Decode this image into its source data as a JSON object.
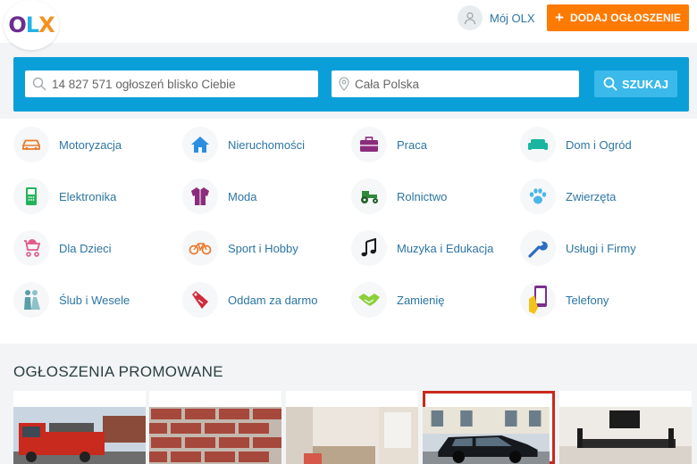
{
  "header": {
    "logo_letters": [
      "O",
      "L",
      "X"
    ],
    "my_olx_label": "Mój OLX",
    "add_listing_label": "DODAJ OGŁOSZENIE"
  },
  "search": {
    "query_placeholder": "14 827 571 ogłoszeń blisko Ciebie",
    "location_placeholder": "Cała Polska",
    "button_label": "SZUKAJ"
  },
  "categories": [
    {
      "label": "Motoryzacja",
      "icon": "car-icon",
      "color": "#e97a2c"
    },
    {
      "label": "Nieruchomości",
      "icon": "house-icon",
      "color": "#2b8fe1"
    },
    {
      "label": "Praca",
      "icon": "briefcase-icon",
      "color": "#8b2c7c"
    },
    {
      "label": "Dom i Ogród",
      "icon": "sofa-icon",
      "color": "#19b5a0"
    },
    {
      "label": "Elektronika",
      "icon": "phone-icon",
      "color": "#23b35a"
    },
    {
      "label": "Moda",
      "icon": "jacket-icon",
      "color": "#8b2c7c"
    },
    {
      "label": "Rolnictwo",
      "icon": "tractor-icon",
      "color": "#2f8a3a"
    },
    {
      "label": "Zwierzęta",
      "icon": "paw-icon",
      "color": "#4cb6e8"
    },
    {
      "label": "Dla Dzieci",
      "icon": "stroller-icon",
      "color": "#e05a8a"
    },
    {
      "label": "Sport i Hobby",
      "icon": "bicycle-icon",
      "color": "#e97a2c"
    },
    {
      "label": "Muzyka i Edukacja",
      "icon": "music-note-icon",
      "color": "#1a1a1a"
    },
    {
      "label": "Usługi i Firmy",
      "icon": "wrench-icon",
      "color": "#2b6cc4"
    },
    {
      "label": "Ślub i Wesele",
      "icon": "wedding-couple-icon",
      "color": "#5a9ea8"
    },
    {
      "label": "Oddam za darmo",
      "icon": "price-tag-icon",
      "color": "#d02c3b"
    },
    {
      "label": "Zamienię",
      "icon": "handshake-icon",
      "color": "#8ccf3b"
    },
    {
      "label": "Telefony",
      "icon": "smartphone-hand-icon",
      "color": "#f2c318"
    }
  ],
  "promoted": {
    "title": "OGŁOSZENIA PROMOWANE",
    "cards": [
      {
        "image": "tow-truck-photo"
      },
      {
        "image": "brick-wall-photo"
      },
      {
        "image": "room-interior-photo"
      },
      {
        "image": "black-car-photo",
        "selected": true
      },
      {
        "image": "living-room-tv-photo"
      }
    ]
  },
  "colors": {
    "accent_orange": "#ff7a00",
    "search_blue": "#0b9fd9",
    "link_blue": "#2c75a3"
  }
}
